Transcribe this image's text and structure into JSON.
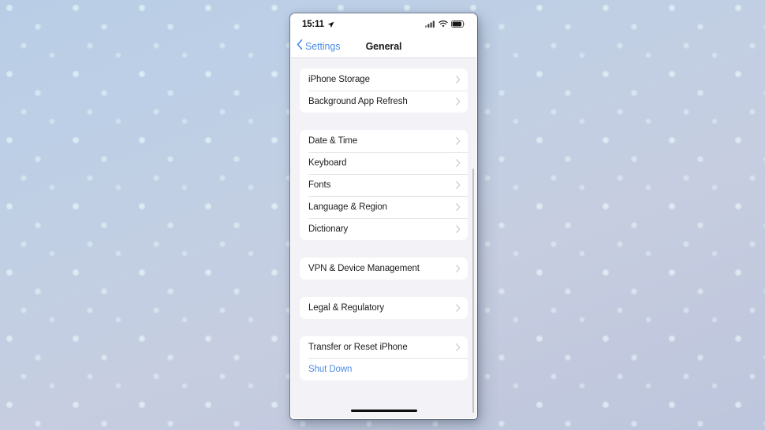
{
  "status_bar": {
    "time": "15:11",
    "location_icon": "location-arrow-icon",
    "cellular_icon": "cellular-signal-icon",
    "wifi_icon": "wifi-icon",
    "battery_icon": "battery-icon"
  },
  "nav": {
    "back_label": "Settings",
    "back_icon": "chevron-left-icon",
    "title": "General"
  },
  "groups": [
    {
      "rows": [
        {
          "label": "iPhone Storage",
          "accessory": "chevron-right-icon",
          "style": "default"
        },
        {
          "label": "Background App Refresh",
          "accessory": "chevron-right-icon",
          "style": "default"
        }
      ]
    },
    {
      "rows": [
        {
          "label": "Date & Time",
          "accessory": "chevron-right-icon",
          "style": "default"
        },
        {
          "label": "Keyboard",
          "accessory": "chevron-right-icon",
          "style": "default"
        },
        {
          "label": "Fonts",
          "accessory": "chevron-right-icon",
          "style": "default"
        },
        {
          "label": "Language & Region",
          "accessory": "chevron-right-icon",
          "style": "default"
        },
        {
          "label": "Dictionary",
          "accessory": "chevron-right-icon",
          "style": "default"
        }
      ]
    },
    {
      "rows": [
        {
          "label": "VPN & Device Management",
          "accessory": "chevron-right-icon",
          "style": "default"
        }
      ]
    },
    {
      "rows": [
        {
          "label": "Legal & Regulatory",
          "accessory": "chevron-right-icon",
          "style": "default"
        }
      ]
    },
    {
      "rows": [
        {
          "label": "Transfer or Reset iPhone",
          "accessory": "chevron-right-icon",
          "style": "default"
        },
        {
          "label": "Shut Down",
          "accessory": "none",
          "style": "blue"
        }
      ]
    }
  ],
  "home_indicator": "home-indicator",
  "colors": {
    "accent_blue": "#4f8ce6",
    "page_background": "#f2f2f7",
    "card_background": "#ffffff",
    "label": "#1c1c1e",
    "separator": "#e6e6ea",
    "chevron": "#c9c9ce"
  }
}
